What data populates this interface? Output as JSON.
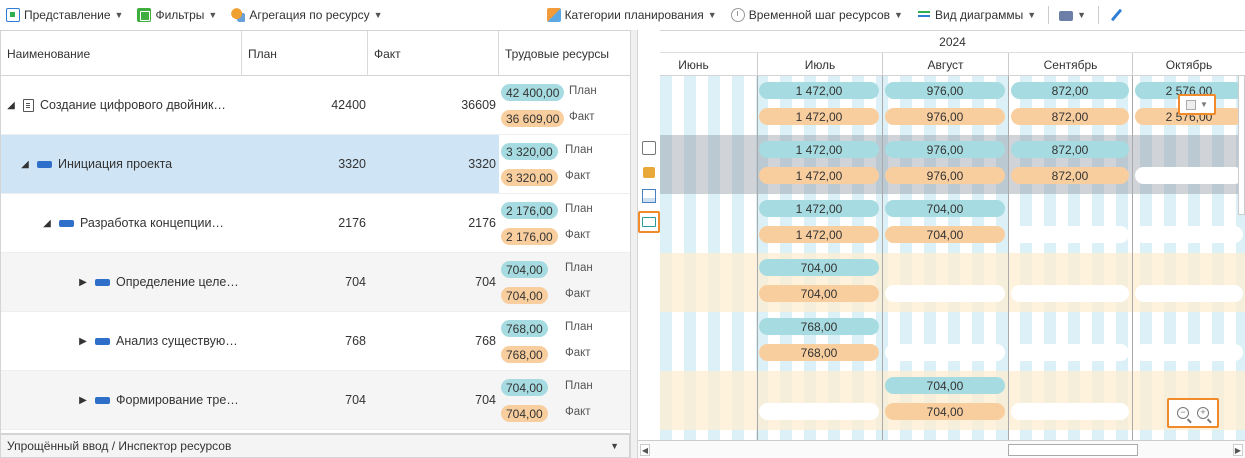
{
  "toolbar": {
    "view_label": "Представление",
    "filters_label": "Фильтры",
    "aggregation_label": "Агрегация по ресурсу",
    "categories_label": "Категории планирования",
    "timestep_label": "Временной шаг ресурсов",
    "diagram_view_label": "Вид диаграммы",
    "arrow": "▼"
  },
  "grid": {
    "headers": {
      "name": "Наименование",
      "plan": "План",
      "fact": "Факт",
      "labor": "Трудовые ресурсы"
    },
    "plan_label": "План",
    "fact_label": "Факт",
    "rows": [
      {
        "name": "Создание цифрового двойник…",
        "plan": "42400",
        "fact": "36609",
        "labor_plan": "42 400,00",
        "labor_fact": "36 609,00",
        "expander": "◢"
      },
      {
        "name": "Инициация проекта",
        "plan": "3320",
        "fact": "3320",
        "labor_plan": "3 320,00",
        "labor_fact": "3 320,00",
        "expander": "◢"
      },
      {
        "name": "Разработка концепции…",
        "plan": "2176",
        "fact": "2176",
        "labor_plan": "2 176,00",
        "labor_fact": "2 176,00",
        "expander": "◢"
      },
      {
        "name": "Определение целе…",
        "plan": "704",
        "fact": "704",
        "labor_plan": "704,00",
        "labor_fact": "704,00",
        "expander": "▶"
      },
      {
        "name": "Анализ существую…",
        "plan": "768",
        "fact": "768",
        "labor_plan": "768,00",
        "labor_fact": "768,00",
        "expander": "▶"
      },
      {
        "name": "Формирование тре…",
        "plan": "704",
        "fact": "704",
        "labor_plan": "704,00",
        "labor_fact": "704,00",
        "expander": "▶"
      }
    ]
  },
  "footer": {
    "panel_label": "Упрощённый ввод / Инспектор ресурсов",
    "arrow": "▼"
  },
  "gantt": {
    "year": "2024",
    "months": [
      "Июнь",
      "Июль",
      "Август",
      "Сентябрь",
      "Октябрь"
    ],
    "rows": [
      {
        "plan": [
          "",
          "1 472,00",
          "976,00",
          "872,00",
          "2 576,00"
        ],
        "fact": [
          "",
          "1 472,00",
          "976,00",
          "872,00",
          "2 576,00"
        ]
      },
      {
        "plan": [
          "",
          "1 472,00",
          "976,00",
          "872,00",
          ""
        ],
        "fact": [
          "",
          "1 472,00",
          "976,00",
          "872,00",
          ""
        ]
      },
      {
        "plan": [
          "",
          "1 472,00",
          "704,00",
          "",
          ""
        ],
        "fact": [
          "",
          "1 472,00",
          "704,00",
          "",
          ""
        ]
      },
      {
        "plan": [
          "",
          "704,00",
          "",
          "",
          ""
        ],
        "fact": [
          "",
          "704,00",
          "",
          "",
          ""
        ]
      },
      {
        "plan": [
          "",
          "768,00",
          "",
          "",
          ""
        ],
        "fact": [
          "",
          "768,00",
          "",
          "",
          ""
        ]
      },
      {
        "plan": [
          "",
          "",
          "704,00",
          "",
          ""
        ],
        "fact": [
          "",
          "",
          "704,00",
          "",
          ""
        ]
      }
    ],
    "zoom_out_symbol": "−",
    "zoom_in_symbol": "+"
  },
  "colors": {
    "plan_pill": "#a6dce1",
    "fact_pill": "#f9ce9e",
    "selection": "#cfe4f4",
    "highlight_border": "#f08a2a"
  }
}
